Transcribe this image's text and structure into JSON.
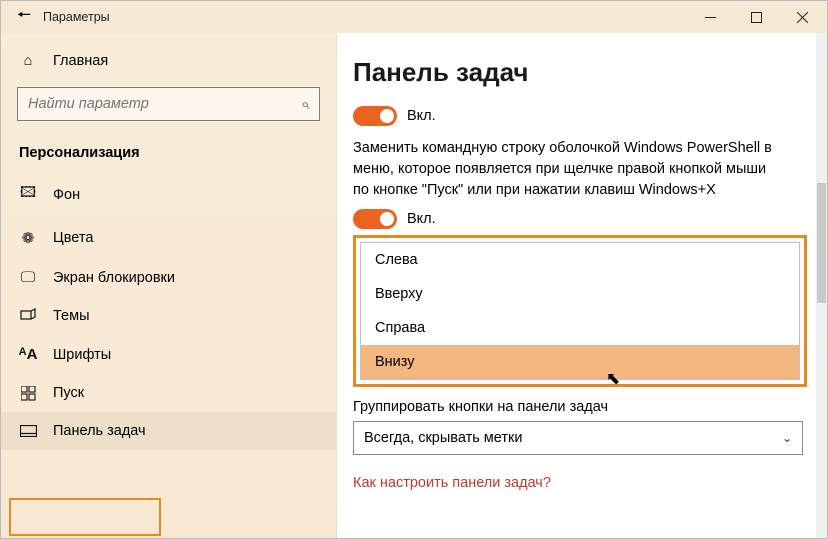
{
  "window": {
    "title": "Параметры"
  },
  "sidebar": {
    "home": "Главная",
    "search_placeholder": "Найти параметр",
    "section": "Персонализация",
    "items": [
      {
        "label": "Фон"
      },
      {
        "label": "Цвета"
      },
      {
        "label": "Экран блокировки"
      },
      {
        "label": "Темы"
      },
      {
        "label": "Шрифты"
      },
      {
        "label": "Пуск"
      },
      {
        "label": "Панель задач"
      }
    ]
  },
  "content": {
    "heading": "Панель задач",
    "toggle1_label": "Вкл.",
    "powershell_desc": "Заменить командную строку оболочкой Windows PowerShell в меню, которое появляется при щелчке правой кнопкой мыши по кнопке \"Пуск\" или при нажатии клавиш Windows+X",
    "toggle2_label": "Вкл.",
    "position_options": [
      "Слева",
      "Вверху",
      "Справа",
      "Внизу"
    ],
    "group_label": "Группировать кнопки на панели задач",
    "group_value": "Всегда, скрывать метки",
    "help_link": "Как настроить панели задач?"
  }
}
